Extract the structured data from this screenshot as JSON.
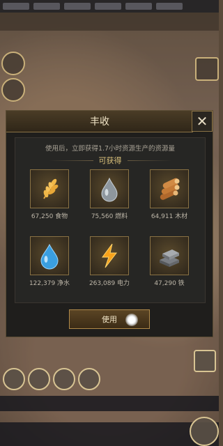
{
  "dialog": {
    "title": "丰收",
    "close_glyph": "✕",
    "description": "使用后，立即获得1.7小时资源生产的资源量",
    "obtain_label": "可获得",
    "use_button_label": "使用"
  },
  "resources": [
    {
      "name": "食物",
      "amount": "67,250",
      "label": "67,250 食物",
      "icon": "wheat-icon"
    },
    {
      "name": "燃料",
      "amount": "75,560",
      "label": "75,560 燃料",
      "icon": "fuel-drop-icon"
    },
    {
      "name": "木材",
      "amount": "64,911",
      "label": "64,911 木材",
      "icon": "wood-logs-icon"
    },
    {
      "name": "净水",
      "amount": "122,379",
      "label": "122,379 净水",
      "icon": "water-drop-icon"
    },
    {
      "name": "电力",
      "amount": "263,089",
      "label": "263,089 电力",
      "icon": "lightning-icon"
    },
    {
      "name": "铁",
      "amount": "47,290",
      "label": "47,290 铁",
      "icon": "iron-ingot-icon"
    }
  ],
  "colors": {
    "accent_gold": "#d9c07a",
    "panel_bg": "#1f1e1c",
    "tile_border": "#8a7244"
  }
}
